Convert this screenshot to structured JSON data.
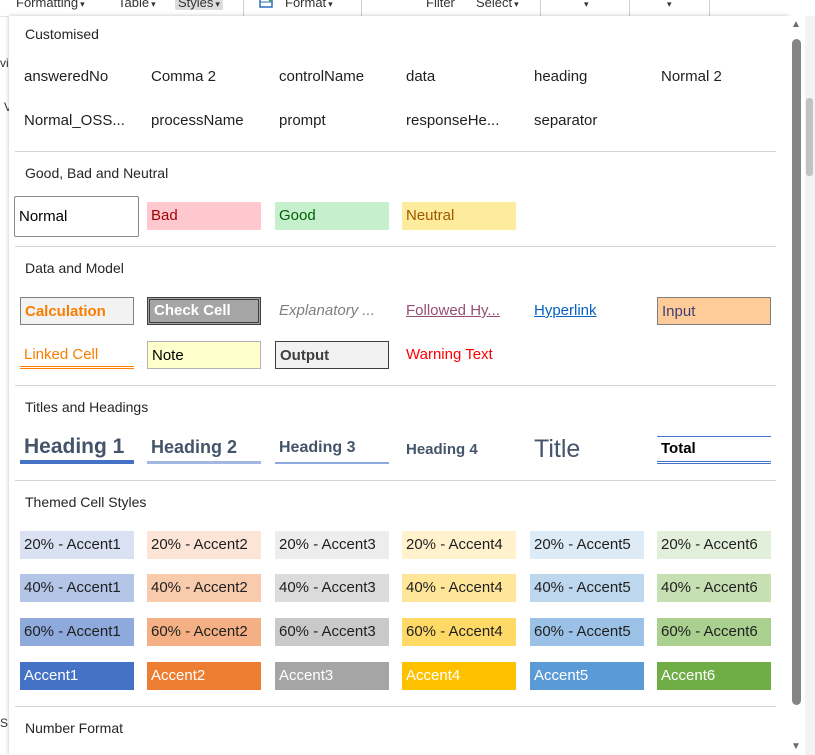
{
  "ribbon": {
    "formatting_label": "Formatting",
    "table_label": "Table",
    "styles_label": "Styles",
    "format_label": "Format",
    "filter_label": "Filter",
    "select_label": "Select",
    "chevron": "▾",
    "behind_text_1": "vit",
    "behind_text_2": "V",
    "behind_text_3": "S"
  },
  "sections": {
    "customised": "Customised",
    "good_bad_neutral": "Good, Bad and Neutral",
    "data_model": "Data and Model",
    "titles_headings": "Titles and Headings",
    "themed": "Themed Cell Styles",
    "number_format": "Number Format"
  },
  "customised": [
    "answeredNo",
    "Comma 2",
    "controlName",
    "data",
    "heading",
    "Normal 2",
    "Normal_OSS...",
    "processName",
    "prompt",
    "responseHe...",
    "separator"
  ],
  "gbn": {
    "normal": "Normal",
    "bad": "Bad",
    "good": "Good",
    "neutral": "Neutral"
  },
  "data_model": {
    "calculation": "Calculation",
    "check_cell": "Check Cell",
    "explanatory": "Explanatory ...",
    "followed_hyperlink": "Followed Hy...",
    "hyperlink": "Hyperlink",
    "input": "Input",
    "linked_cell": "Linked Cell",
    "note": "Note",
    "output": "Output",
    "warning": "Warning Text"
  },
  "titles": {
    "heading1": "Heading 1",
    "heading2": "Heading 2",
    "heading3": "Heading 3",
    "heading4": "Heading 4",
    "title": "Title",
    "total": "Total"
  },
  "themed": {
    "r20": [
      "20% - Accent1",
      "20% - Accent2",
      "20% - Accent3",
      "20% - Accent4",
      "20% - Accent5",
      "20% - Accent6"
    ],
    "r40": [
      "40% - Accent1",
      "40% - Accent2",
      "40% - Accent3",
      "40% - Accent4",
      "40% - Accent5",
      "40% - Accent6"
    ],
    "r60": [
      "60% - Accent1",
      "60% - Accent2",
      "60% - Accent3",
      "60% - Accent4",
      "60% - Accent5",
      "60% - Accent6"
    ],
    "accent": [
      "Accent1",
      "Accent2",
      "Accent3",
      "Accent4",
      "Accent5",
      "Accent6"
    ]
  },
  "scrollbar": {
    "up": "▲",
    "down": "▼"
  },
  "colors": {
    "accent1": "#4472c4",
    "accent2": "#ed7d31",
    "accent3": "#a5a5a5",
    "accent4": "#ffc000",
    "accent5": "#5b9bd5",
    "accent6": "#70ad47"
  }
}
